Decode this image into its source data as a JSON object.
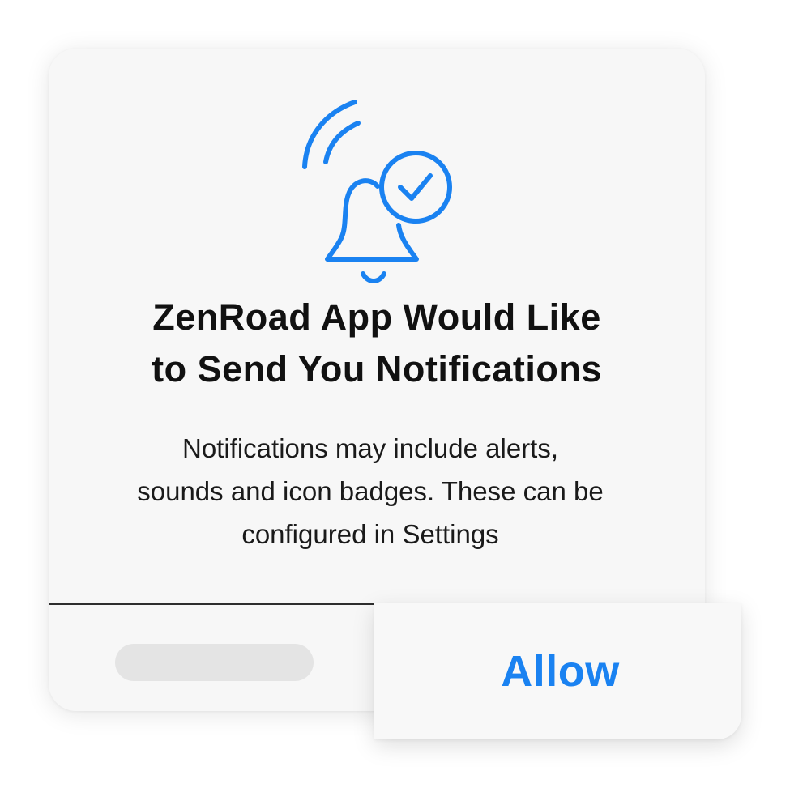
{
  "dialog": {
    "icon": "bell-ringing-check-icon",
    "accent_color": "#1a82f1",
    "title_line1": "ZenRoad App Would Like",
    "title_line2": "to Send You Notifications",
    "message_line1": "Notifications may include alerts,",
    "message_line2": "sounds and icon badges. These can be",
    "message_line3": "configured in Settings",
    "deny_label": "",
    "allow_label": "Allow"
  }
}
